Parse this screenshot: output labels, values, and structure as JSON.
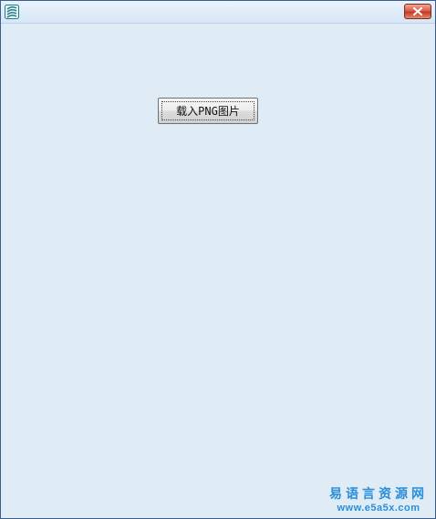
{
  "window": {
    "title": "",
    "icon": "e-language-app-icon",
    "close_icon": "close-icon"
  },
  "main": {
    "load_button_label": "载入PNG图片"
  },
  "watermark": {
    "chinese_text": "易语言资源网",
    "url": "www.e5a5x.com"
  },
  "colors": {
    "client_background": "#dfecf6",
    "close_button": "#c03a23",
    "watermark": "#2a8ed8"
  }
}
